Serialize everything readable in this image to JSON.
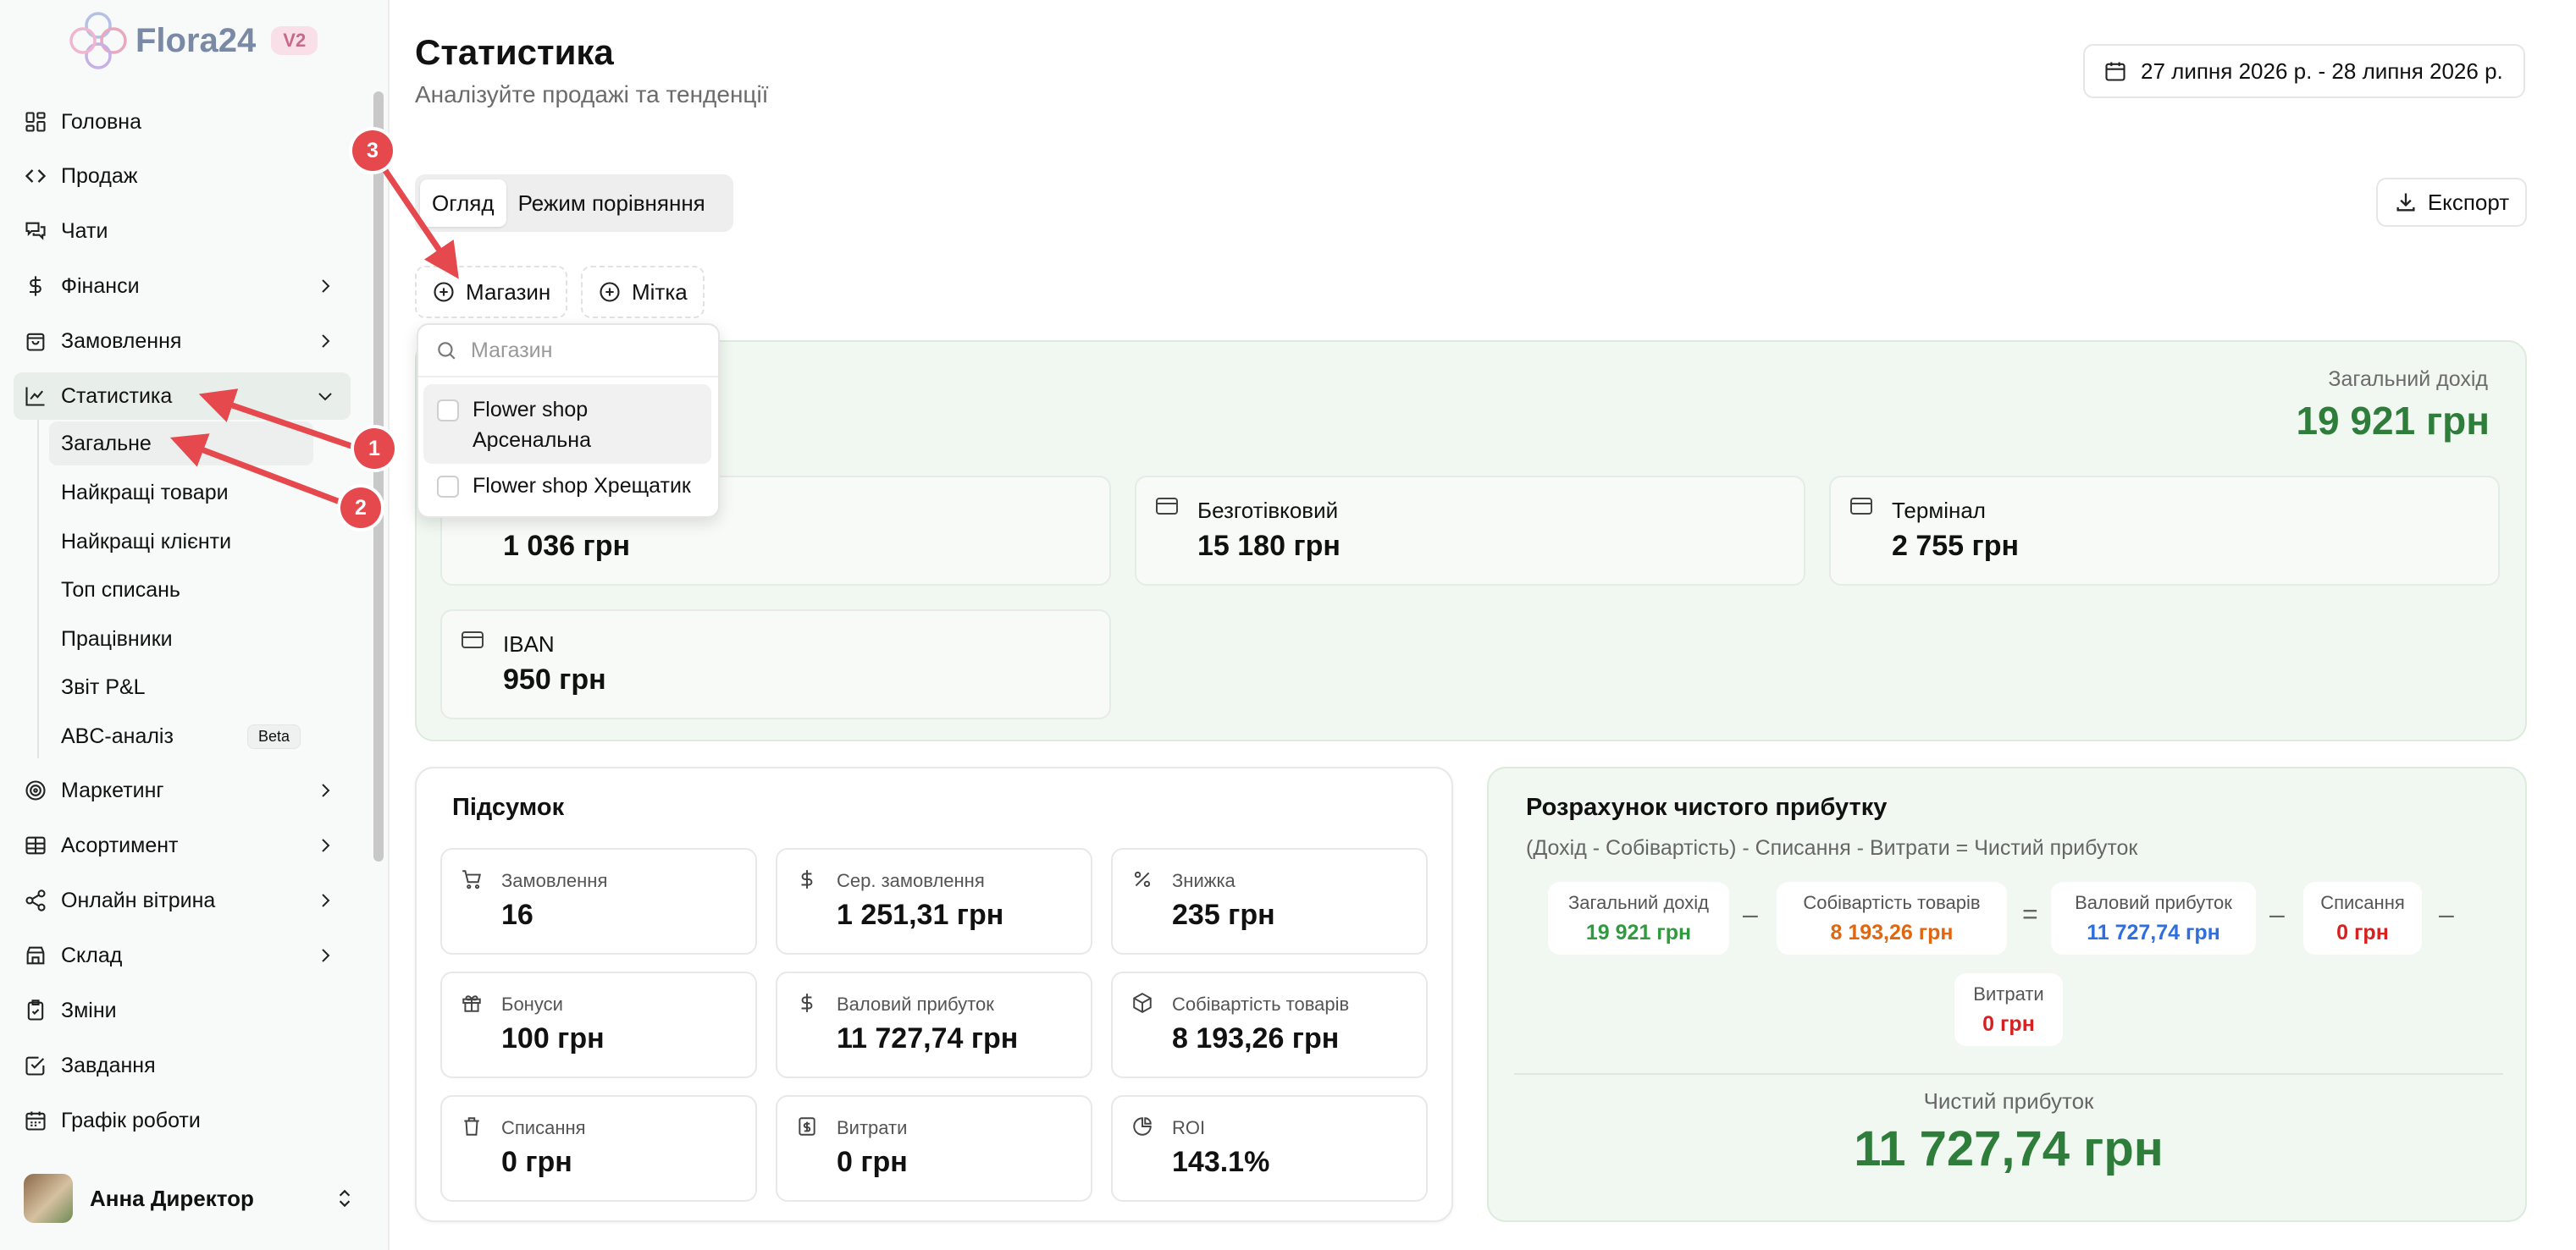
{
  "app": {
    "name": "Flora24",
    "version": "V2"
  },
  "sidebar": {
    "items": [
      {
        "label": "Головна"
      },
      {
        "label": "Продаж"
      },
      {
        "label": "Чати"
      },
      {
        "label": "Фінанси"
      },
      {
        "label": "Замовлення"
      },
      {
        "label": "Статистика"
      },
      {
        "label": "Маркетинг"
      },
      {
        "label": "Асортимент"
      },
      {
        "label": "Онлайн вітрина"
      },
      {
        "label": "Склад"
      },
      {
        "label": "Зміни"
      },
      {
        "label": "Завдання"
      },
      {
        "label": "Графік роботи"
      }
    ],
    "stats_sub": [
      {
        "label": "Загальне"
      },
      {
        "label": "Найкращі товари"
      },
      {
        "label": "Найкращі клієнти"
      },
      {
        "label": "Топ списань"
      },
      {
        "label": "Працівники"
      },
      {
        "label": "Звіт P&L"
      },
      {
        "label": "ABC-аналіз"
      }
    ],
    "beta_badge": "Beta",
    "user": {
      "name": "Анна Директор"
    }
  },
  "header": {
    "title": "Статистика",
    "subtitle": "Аналізуйте продажі та тенденції",
    "date_range": "27 липня 2026 р. - 28 липня 2026 р."
  },
  "tabs": [
    {
      "label": "Огляд"
    },
    {
      "label": "Режим порівняння"
    }
  ],
  "export_label": "Експорт",
  "filters": {
    "store": "Магазин",
    "tag": "Мітка"
  },
  "store_popup": {
    "placeholder": "Магазин",
    "options": [
      {
        "label": "Flower shop Арсенальна"
      },
      {
        "label": "Flower shop Хрещатик"
      }
    ]
  },
  "income": {
    "total_label": "Загальний дохід",
    "total": "19 921 грн",
    "methods": [
      {
        "label": "",
        "value": "1 036 грн"
      },
      {
        "label": "Безготівковий",
        "value": "15 180 грн"
      },
      {
        "label": "Термінал",
        "value": "2 755 грн"
      },
      {
        "label": "IBAN",
        "value": "950 грн"
      }
    ]
  },
  "summary": {
    "title": "Підсумок",
    "stats": [
      {
        "label": "Замовлення",
        "value": "16",
        "icon": "cart-icon"
      },
      {
        "label": "Сер. замовлення",
        "value": "1 251,31 грн",
        "icon": "dollar-icon"
      },
      {
        "label": "Знижка",
        "value": "235 грн",
        "icon": "percent-icon"
      },
      {
        "label": "Бонуси",
        "value": "100 грн",
        "icon": "gift-icon"
      },
      {
        "label": "Валовий прибуток",
        "value": "11 727,74 грн",
        "icon": "dollar-icon"
      },
      {
        "label": "Собівартість товарів",
        "value": "8 193,26 грн",
        "icon": "box-icon"
      },
      {
        "label": "Списання",
        "value": "0 грн",
        "icon": "trash-icon"
      },
      {
        "label": "Витрати",
        "value": "0 грн",
        "icon": "receipt-icon"
      },
      {
        "label": "ROI",
        "value": "143.1%",
        "icon": "pie-icon"
      }
    ]
  },
  "net_profit": {
    "title": "Розрахунок чистого прибутку",
    "formula": "(Дохід - Собівартість) - Списання - Витрати = Чистий прибуток",
    "terms": [
      {
        "label": "Загальний дохід",
        "value": "19 921 грн",
        "color": "#2f9a3f"
      },
      {
        "label": "Собівартість товарів",
        "value": "8 193,26 грн",
        "color": "#e0660f"
      },
      {
        "label": "Валовий прибуток",
        "value": "11 727,74 грн",
        "color": "#2f6ee0"
      },
      {
        "label": "Списання",
        "value": "0 грн",
        "color": "#d82020"
      },
      {
        "label": "Витрати",
        "value": "0 грн",
        "color": "#d82020"
      }
    ],
    "ops": [
      "–",
      "=",
      "–",
      "–"
    ],
    "result_label": "Чистий прибуток",
    "result": "11 727,74 грн"
  },
  "annotations": [
    "1",
    "2",
    "3"
  ],
  "colors": {
    "accent_green": "#2f7d3a",
    "annotation_red": "#e5484d"
  }
}
